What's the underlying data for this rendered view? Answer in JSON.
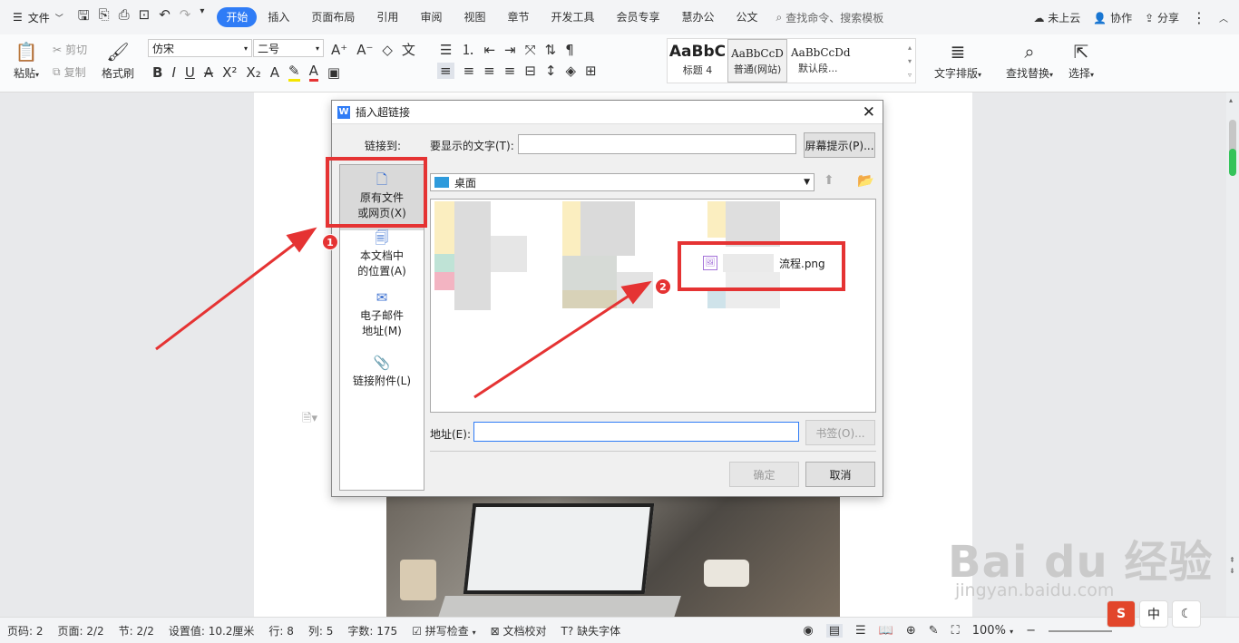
{
  "menubar": {
    "file_label": "文件",
    "tabs": [
      "开始",
      "插入",
      "页面布局",
      "引用",
      "审阅",
      "视图",
      "章节",
      "开发工具",
      "会员专享",
      "慧办公",
      "公文"
    ],
    "search_placeholder": "查找命令、搜索模板",
    "cloud_label": "未上云",
    "collab_label": "协作",
    "share_label": "分享"
  },
  "ribbon": {
    "paste": "粘贴",
    "cut": "剪切",
    "copy": "复制",
    "format_painter": "格式刷",
    "font_name": "仿宋",
    "font_size": "二号",
    "styles": [
      {
        "preview": "AaBbC",
        "label": "标题 4"
      },
      {
        "preview": "AaBbCcD",
        "label": "普通(网站)"
      },
      {
        "preview": "AaBbCcDd",
        "label": "默认段..."
      }
    ],
    "text_layout": "文字排版",
    "find_replace": "查找替换",
    "select": "选择"
  },
  "dialog": {
    "title": "插入超链接",
    "link_to_label": "链接到:",
    "display_text_label": "要显示的文字(T):",
    "display_text_value": "",
    "screen_tip_button": "屏幕提示(P)...",
    "nav": {
      "existing_file_1": "原有文件",
      "existing_file_2": "或网页(X)",
      "this_doc_1": "本文档中",
      "this_doc_2": "的位置(A)",
      "email_1": "电子邮件",
      "email_2": "地址(M)",
      "attachment": "链接附件(L)"
    },
    "folder": "桌面",
    "file_name": "流程.png",
    "address_label": "地址(E):",
    "address_value": "",
    "bookmark_button": "书签(O)...",
    "ok_button": "确定",
    "cancel_button": "取消"
  },
  "annotations": {
    "badge1": "1",
    "badge2": "2",
    "color": "#e53333"
  },
  "statusbar": {
    "page_num": "页码: 2",
    "pages": "页面: 2/2",
    "section": "节: 2/2",
    "setting": "设置值: 10.2厘米",
    "row": "行: 8",
    "col": "列: 5",
    "word_count": "字数: 175",
    "spell_check": "拼写检查",
    "doc_proof": "文档校对",
    "missing_font": "缺失字体",
    "zoom": "100%"
  },
  "ime": {
    "logo": "S",
    "mode": "中"
  },
  "watermark": {
    "text": "Bai du 经验",
    "sub": "jingyan.baidu.com"
  },
  "colors": {
    "accent": "#2f7cf6",
    "annotation": "#e53333"
  }
}
